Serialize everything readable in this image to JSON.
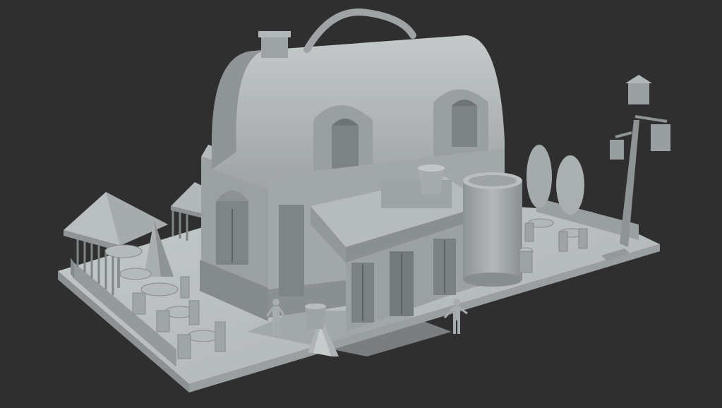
{
  "scene": {
    "background_color": "#2f2f2f",
    "material_color": "#a9aeb0",
    "shadow_color": "#6f7476",
    "highlight_color": "#c7cccd"
  }
}
